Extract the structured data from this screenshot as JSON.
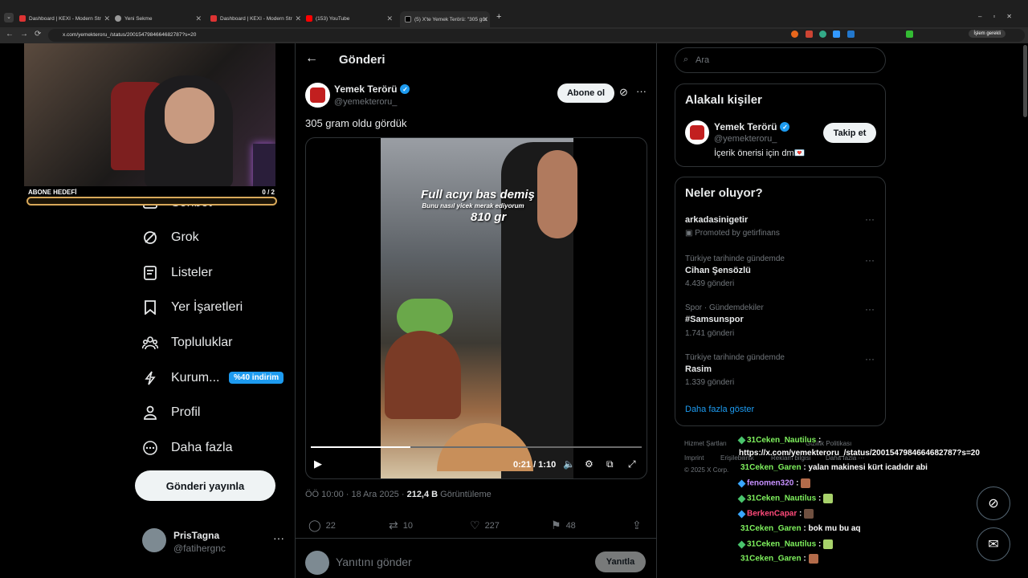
{
  "browser": {
    "tabs": [
      {
        "label": "Dashboard | KEXI - Modern Str"
      },
      {
        "label": "Yeni Sekme"
      },
      {
        "label": "Dashboard | KEXI - Modern Str"
      },
      {
        "label": "(153) YouTube"
      },
      {
        "label": "(5) X'te Yemek Terörü: \"305 gra"
      }
    ],
    "new_tab": "+",
    "url": "x.com/yemekteroru_/status/2001547984664682787?s=20",
    "islem_label": "İşlem gerekli",
    "colors": {
      "tabbar": "#1f1f1f",
      "accent": "#1d9bf0"
    }
  },
  "stream": {
    "goal_label": "ABONE HEDEFİ",
    "goal_count": "0 / 2",
    "goal_progress": 0
  },
  "nav": {
    "items": [
      {
        "label": "Sohbet",
        "icon": "mail-icon"
      },
      {
        "label": "Grok",
        "icon": "grok-icon"
      },
      {
        "label": "Listeler",
        "icon": "list-icon"
      },
      {
        "label": "Yer İşaretleri",
        "icon": "bookmark-icon"
      },
      {
        "label": "Topluluklar",
        "icon": "communities-icon"
      },
      {
        "label": "Kurum...",
        "icon": "lightning-icon"
      },
      {
        "label": "Profil",
        "icon": "person-icon"
      },
      {
        "label": "Daha fazla",
        "icon": "more-circle-icon"
      }
    ],
    "badge": "%40 indirim",
    "post_button": "Gönderi yayınla",
    "account": {
      "name": "PrisTagna",
      "handle": "@fatihergnc"
    }
  },
  "post": {
    "page_title": "Gönderi",
    "author": "Yemek Terörü",
    "handle": "@yemekteroru_",
    "subscribe": "Abone ol",
    "text": "305 gram oldu gördük",
    "video": {
      "caption1": "Full acıyı bas demiş",
      "caption2": "Bunu nasıl yicek merak ediyorum",
      "caption3": "810 gr",
      "time": "0:21 / 1:10",
      "progress": 0.3
    },
    "time": "ÖÖ 10:00 · 18 Ara 2025 · ",
    "views": "212,4 B",
    "views_label": " Görüntüleme",
    "stats": {
      "replies": "22",
      "reposts": "10",
      "likes": "227",
      "bookmarks": "48"
    },
    "reply_placeholder": "Yanıtını gönder",
    "reply_button": "Yanıtla"
  },
  "right": {
    "search_placeholder": "Ara",
    "related_title": "Alakalı kişiler",
    "related": {
      "name": "Yemek Terörü",
      "handle": "@yemekteroru_",
      "bio": "İçerik önerisi için dm💌",
      "follow": "Takip et"
    },
    "trends_title": "Neler oluyor?",
    "trends": [
      {
        "context": "",
        "title": "arkadasinigetir",
        "count": "Promoted by getirfinans"
      },
      {
        "context": "Türkiye tarihinde gündemde",
        "title": "Cihan Şensözlü",
        "count": "4.439 gönderi"
      },
      {
        "context": "Spor · Gündemdekiler",
        "title": "#Samsunspor",
        "count": "1.741 gönderi"
      },
      {
        "context": "Türkiye tarihinde gündemde",
        "title": "Rasim",
        "count": "1.339 gönderi"
      }
    ],
    "show_more": "Daha fazla göster",
    "footer": [
      "Hizmet Şartları",
      "Gizlilik Politikası",
      "Imprint",
      "Erişilebilirlik",
      "Reklam bilgisi",
      "Daha fazla ···",
      "© 2025 X Corp."
    ]
  },
  "chat": [
    {
      "user": "31Ceken_Nautilus",
      "msg": ":"
    },
    {
      "user": "",
      "msg": "https://x.com/yemekteroru_/status/2001547984664682787?s=20"
    },
    {
      "user": "31Ceken_Garen",
      "msg": ": yalan makinesi kürt icadıdır abi"
    },
    {
      "user": "fenomen320",
      "msg": ":"
    },
    {
      "user": "31Ceken_Nautilus",
      "msg": ":"
    },
    {
      "user": "BerkenCapar",
      "msg": ":"
    },
    {
      "user": "31Ceken_Garen",
      "msg": ": bok mu bu aq"
    },
    {
      "user": "31Ceken_Nautilus",
      "msg": ":"
    },
    {
      "user": "31Ceken_Garen",
      "msg": ":"
    }
  ]
}
